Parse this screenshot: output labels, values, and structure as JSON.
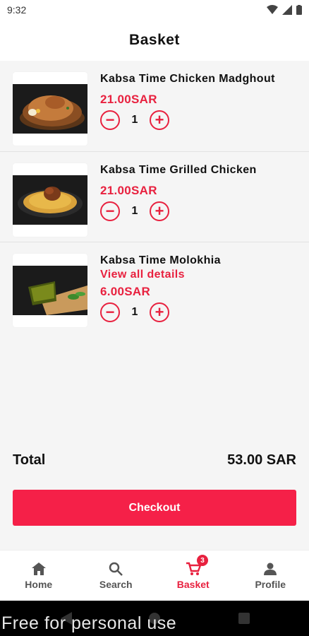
{
  "status_bar": {
    "time": "9:32"
  },
  "header": {
    "title": "Basket"
  },
  "items": [
    {
      "name": "Kabsa Time Chicken Madghout",
      "details": "",
      "price": "21.00SAR",
      "qty": "1",
      "decrease": "−",
      "increase": "+"
    },
    {
      "name": "Kabsa Time Grilled Chicken",
      "details": "",
      "price": "21.00SAR",
      "qty": "1",
      "decrease": "−",
      "increase": "+"
    },
    {
      "name": "Kabsa Time Molokhia",
      "details": "View all details",
      "price": "6.00SAR",
      "qty": "1",
      "decrease": "−",
      "increase": "+"
    }
  ],
  "total": {
    "label": "Total",
    "value": "53.00 SAR"
  },
  "checkout_label": "Checkout",
  "nav": {
    "home": "Home",
    "search": "Search",
    "basket": "Basket",
    "basket_badge": "3",
    "profile": "Profile"
  },
  "watermark": "Free for personal use",
  "colors": {
    "accent": "#e8213f",
    "checkout": "#f52048"
  }
}
